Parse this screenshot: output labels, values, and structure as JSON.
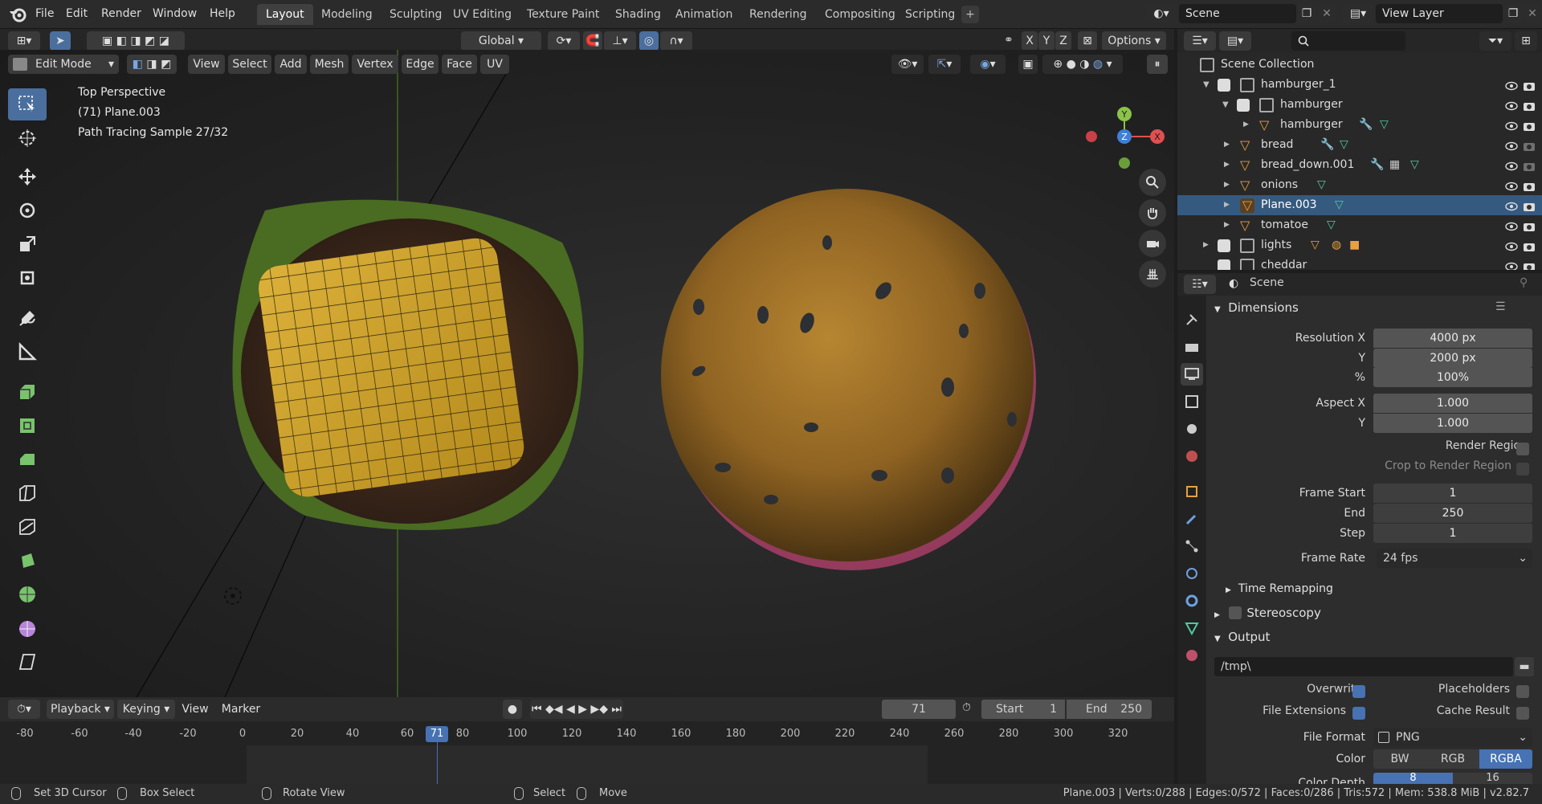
{
  "menu": [
    "File",
    "Edit",
    "Render",
    "Window",
    "Help"
  ],
  "workspaces": [
    "Layout",
    "Modeling",
    "Sculpting",
    "UV Editing",
    "Texture Paint",
    "Shading",
    "Animation",
    "Rendering",
    "Compositing",
    "Scripting"
  ],
  "scene_name": "Scene",
  "view_layer": "View Layer",
  "vp_header": {
    "mode": "Edit Mode",
    "menus": [
      "View",
      "Select",
      "Add",
      "Mesh",
      "Vertex",
      "Edge",
      "Face",
      "UV"
    ],
    "orientation": "Global",
    "axes": [
      "X",
      "Y",
      "Z"
    ],
    "options": "Options"
  },
  "overlay": {
    "line1": "Top Perspective",
    "line2": "(71) Plane.003",
    "line3": "Path Tracing Sample 27/32"
  },
  "gizmo": {
    "y": "Y",
    "z": "Z",
    "x": "X"
  },
  "outliner": {
    "root": "Scene Collection",
    "rows": [
      {
        "label": "hamburger_1"
      },
      {
        "label": "hamburger"
      },
      {
        "label": "hamburger"
      },
      {
        "label": "bread"
      },
      {
        "label": "bread_down.001"
      },
      {
        "label": "onions"
      },
      {
        "label": "Plane.003"
      },
      {
        "label": "tomatoe"
      },
      {
        "label": "lights"
      },
      {
        "label": "cheddar"
      }
    ]
  },
  "props": {
    "context": "Scene",
    "dimensions": "Dimensions",
    "res_x_label": "Resolution X",
    "res_x": "4000 px",
    "res_y_label": "Y",
    "res_y": "2000 px",
    "pct_label": "%",
    "pct": "100%",
    "aspect_x_label": "Aspect X",
    "aspect_x": "1.000",
    "aspect_y_label": "Y",
    "aspect_y": "1.000",
    "render_region": "Render Region",
    "crop_region": "Crop to Render Region",
    "frame_start_label": "Frame Start",
    "frame_start": "1",
    "end_label": "End",
    "end": "250",
    "step_label": "Step",
    "step": "1",
    "frame_rate_label": "Frame Rate",
    "frame_rate": "24 fps",
    "time_remapping": "Time Remapping",
    "stereoscopy": "Stereoscopy",
    "output": "Output",
    "path": "/tmp\\",
    "overwrite": "Overwrite",
    "placeholders": "Placeholders",
    "file_ext": "File Extensions",
    "cache_result": "Cache Result",
    "file_format_label": "File Format",
    "file_format": "PNG",
    "color_label": "Color",
    "color_opts": [
      "BW",
      "RGB",
      "RGBA"
    ],
    "color_depth_label": "Color Depth",
    "color_depth": [
      "8",
      "16"
    ]
  },
  "timeline": {
    "menus": [
      "Playback",
      "Keying",
      "View",
      "Marker"
    ],
    "current": "71",
    "start_label": "Start",
    "start": "1",
    "end_label": "End",
    "end": "250",
    "ticks": [
      "-80",
      "-60",
      "-40",
      "-20",
      "0",
      "20",
      "40",
      "60",
      "80",
      "100",
      "120",
      "140",
      "160",
      "180",
      "200",
      "220",
      "240",
      "260",
      "280",
      "300",
      "320"
    ],
    "frame_marker": "71"
  },
  "status": {
    "a": "Set 3D Cursor",
    "b": "Box Select",
    "c": "Rotate View",
    "d": "Select",
    "e": "Move",
    "stats": "Plane.003 | Verts:0/288 | Edges:0/572 | Faces:0/286 | Tris:572 | Mem: 538.8 MiB | v2.82.7"
  }
}
